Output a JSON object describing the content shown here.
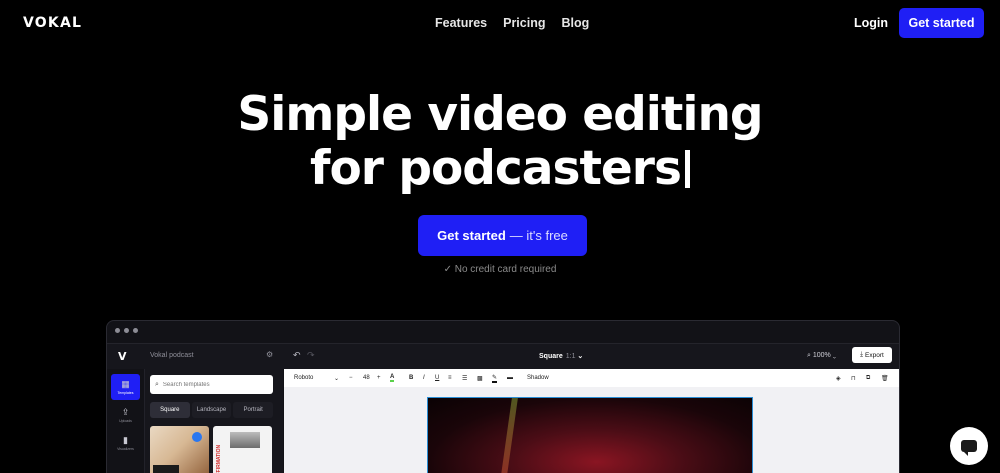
{
  "brand": "VOKAL",
  "nav": {
    "links": [
      "Features",
      "Pricing",
      "Blog"
    ],
    "login": "Login",
    "cta": "Get started"
  },
  "hero": {
    "title_line1": "Simple video editing",
    "title_line2": "for podcasters",
    "cta_bold": "Get started",
    "cta_rest": "— it's free",
    "note": "✓ No credit card required"
  },
  "app": {
    "project_name": "Vokal podcast",
    "format": "Square",
    "ratio": "1:1",
    "zoom": "100%",
    "export_label": "Export",
    "rail": [
      {
        "icon": "grid-icon",
        "glyph": "▦",
        "label": "Templates"
      },
      {
        "icon": "upload-icon",
        "glyph": "⇪",
        "label": "Uploads"
      },
      {
        "icon": "waveform-icon",
        "glyph": "▮",
        "label": "Visualizers"
      }
    ],
    "search_placeholder": "Search templates",
    "segments": [
      "Square",
      "Landscape",
      "Portrait"
    ],
    "toolbar": {
      "font": "Roboto",
      "size": "48",
      "shadow_label": "Shadow"
    },
    "template_text": "AFFIRMATION"
  },
  "colors": {
    "accent": "#1f1ff5",
    "background": "#000000"
  }
}
